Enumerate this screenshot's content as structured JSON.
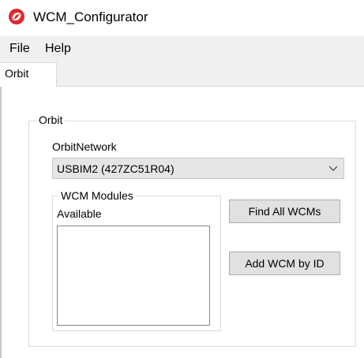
{
  "window": {
    "title": "WCM_Configurator",
    "icon": "red-swirl-logo-icon",
    "accent": "#e0282d"
  },
  "menu": {
    "items": [
      "File",
      "Help"
    ]
  },
  "tabs": [
    {
      "label": "Orbit",
      "selected": true
    }
  ],
  "orbit_group": {
    "legend": "Orbit",
    "network_label": "OrbitNetwork",
    "network_value": "USBIM2 (427ZC51R04)",
    "wcm_modules": {
      "legend": "WCM Modules",
      "available_label": "Available",
      "items": []
    },
    "buttons": {
      "find_all": "Find All WCMs",
      "add_by_id": "Add WCM by ID"
    }
  }
}
